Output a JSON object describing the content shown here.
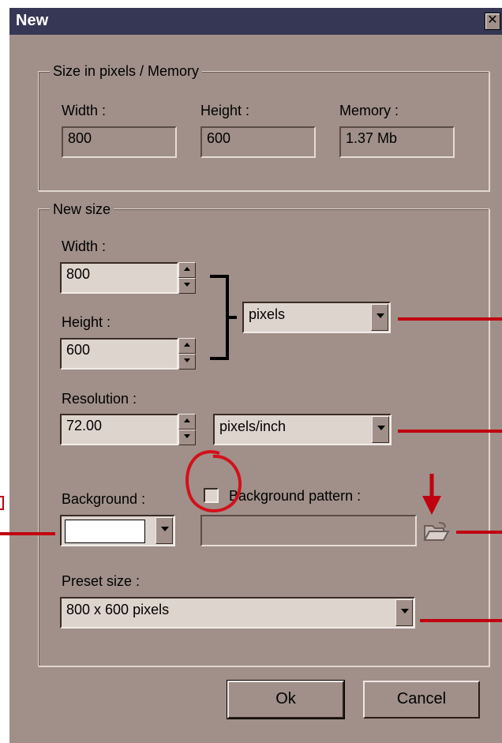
{
  "window": {
    "title": "New",
    "close_glyph": "✕"
  },
  "memory_group": {
    "title": "Size in pixels / Memory",
    "width_label": "Width :",
    "width_value": "800",
    "height_label": "Height :",
    "height_value": "600",
    "memory_label": "Memory :",
    "memory_value": "1.37 Mb"
  },
  "new_size_group": {
    "title": "New size",
    "width_label": "Width :",
    "width_value": "800",
    "height_label": "Height :",
    "height_value": "600",
    "unit_selected": "pixels",
    "resolution_label": "Resolution :",
    "resolution_value": "72.00",
    "resolution_unit_selected": "pixels/inch",
    "background_label": "Background :",
    "background_color": "#ffffff",
    "background_pattern_label": "Background pattern :",
    "background_pattern_checked": false,
    "background_pattern_path": "",
    "preset_label": "Preset size :",
    "preset_selected": "800 x 600 pixels"
  },
  "buttons": {
    "ok_label": "Ok",
    "cancel_label": "Cancel"
  },
  "colors": {
    "dialog_bg": "#a09089",
    "titlebar_bg": "#363655",
    "annotation_red": "#c00010"
  }
}
